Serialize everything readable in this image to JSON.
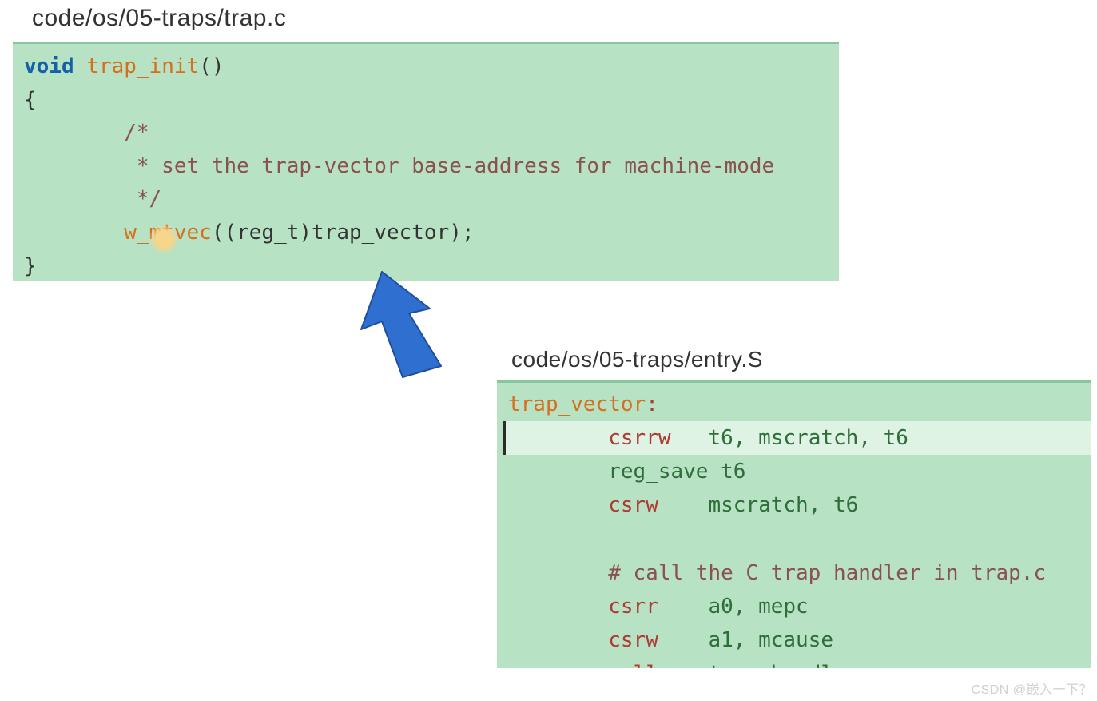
{
  "file1": {
    "path": "code/os/05-traps/trap.c",
    "kw_void": "void",
    "fn_name": "trap_init",
    "paren_open": "()",
    "brace_open": "{",
    "cmt_l1": "        /*",
    "cmt_l2": "         * set the trap-vector base-address for machine-mode",
    "cmt_l3": "         */",
    "call_indent": "        ",
    "call_fn": "w_mtvec",
    "call_args": "((reg_t)trap_vector);",
    "brace_close": "}"
  },
  "file2": {
    "path": "code/os/05-traps/entry.S",
    "label": "trap_vector",
    "colon": ":",
    "l1_instr": "csrrw",
    "l1_ops": "t6, mscratch, t6",
    "l2_instr": "reg_save",
    "l2_ops": "t6",
    "l3_instr": "csrw",
    "l3_ops": "mscratch, t6",
    "blank": " ",
    "cmt": "        # call the C trap handler in trap.c",
    "l5_instr": "csrr",
    "l5_ops": "a0, mepc",
    "l6_instr": "csrw",
    "l6_ops": "a1, mcause",
    "l7_instr": "call",
    "l7_ops": "trap_handler"
  },
  "watermark": "CSDN @嵌入一下？"
}
